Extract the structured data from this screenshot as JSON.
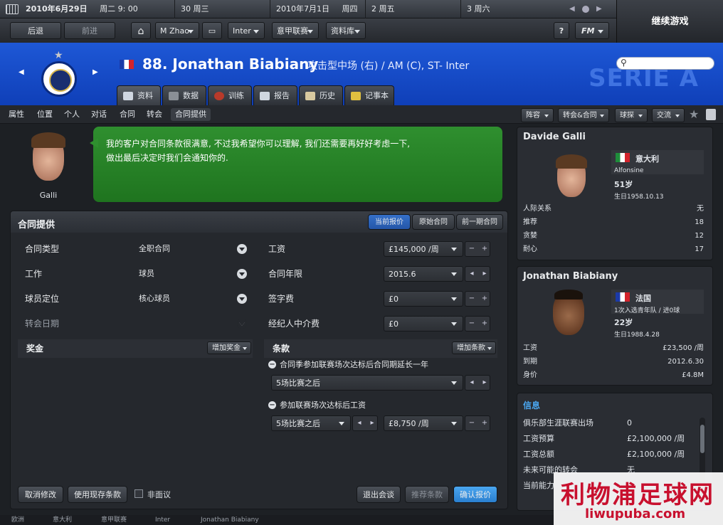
{
  "calendar": {
    "dates": [
      {
        "date": "2010年6月29日",
        "weekday": "周二 9: 00"
      },
      {
        "date": "30 周三",
        "weekday": ""
      },
      {
        "date": "2010年7月1日",
        "weekday": "周四"
      },
      {
        "date": "2 周五",
        "weekday": ""
      },
      {
        "date": "3 周六",
        "weekday": ""
      }
    ]
  },
  "continue_label": "继续游戏",
  "nav": {
    "back": "后退",
    "forward": "前进",
    "manager": "M Zhao",
    "club": "Inter",
    "league": "意甲联赛",
    "database": "资料库",
    "help": "?",
    "fm": "FM"
  },
  "player": {
    "title": "88. Jonathan Biabiany",
    "subtitle": "攻击型中场 (右) / AM (C), ST- Inter",
    "league_logo_text": "SERIE A"
  },
  "header_tabs": [
    {
      "label": "资料",
      "color": "#cfd6e0"
    },
    {
      "label": "数据",
      "color": "#8a8f96"
    },
    {
      "label": "训练",
      "color": "#b83a2a"
    },
    {
      "label": "报告",
      "color": "#cfd6e0"
    },
    {
      "label": "历史",
      "color": "#d8c9a0"
    },
    {
      "label": "记事本",
      "color": "#e0c040"
    }
  ],
  "sub_tabs": [
    "属性",
    "位置",
    "个人",
    "对话",
    "合同",
    "转会",
    "合同提供"
  ],
  "sub_buttons": [
    "阵容",
    "转会&合同",
    "球探",
    "交流"
  ],
  "agent": {
    "name": "Galli",
    "message_line1": "我的客户对合同条款很满意, 不过我希望你可以理解, 我们还需要再好好考虑一下,",
    "message_line2": "做出最后决定时我们会通知你的."
  },
  "offer": {
    "title": "合同提供",
    "view_tabs": [
      "当前报价",
      "原始合同",
      "前一期合同"
    ],
    "left_fields": [
      {
        "label": "合同类型",
        "value": "全职合同"
      },
      {
        "label": "工作",
        "value": "球员"
      },
      {
        "label": "球员定位",
        "value": "核心球员"
      },
      {
        "label": "转会日期",
        "value": ""
      }
    ],
    "right_fields": [
      {
        "label": "工资",
        "value": "£145,000 /周"
      },
      {
        "label": "合同年限",
        "value": "2015.6"
      },
      {
        "label": "签字费",
        "value": "£0"
      },
      {
        "label": "经纪人中介费",
        "value": "£0"
      }
    ],
    "bonus_title": "奖金",
    "bonus_add": "增加奖金",
    "clauses_title": "条款",
    "clauses_add": "增加条款",
    "clauses": [
      {
        "label": "合同季参加联赛场次达标后合同期延长一年",
        "option": "5场比赛之后",
        "value": ""
      },
      {
        "label": "参加联赛场次达标后工资",
        "option": "5场比赛之后",
        "value": "£8,750 /周"
      }
    ],
    "buttons": {
      "cancel": "取消修改",
      "use_existing": "使用现存条款",
      "non_negotiable": "非面议",
      "leave": "退出会谈",
      "suggest": "推荐条款",
      "confirm": "确认报价"
    }
  },
  "agent_card": {
    "name": "Davide Galli",
    "nationality": "意大利",
    "city": "Alfonsine",
    "age": "51岁",
    "birth": "生日1958.10.13",
    "rows": [
      {
        "k": "人际关系",
        "v": "无"
      },
      {
        "k": "推荐",
        "v": "18"
      },
      {
        "k": "贪婪",
        "v": "12"
      },
      {
        "k": "耐心",
        "v": "17"
      }
    ]
  },
  "player_card": {
    "name": "Jonathan Biabiany",
    "nationality": "法国",
    "caps": "1次入选青年队 / 进0球",
    "age": "22岁",
    "birth": "生日1988.4.28",
    "rows": [
      {
        "k": "工资",
        "v": "£23,500 /周"
      },
      {
        "k": "到期",
        "v": "2012.6.30"
      },
      {
        "k": "身价",
        "v": "£4.8M"
      }
    ]
  },
  "info_card": {
    "title": "信息",
    "rows": [
      {
        "k": "俱乐部生涯联赛出场",
        "v": "0"
      },
      {
        "k": "工资预算",
        "v": "£2,100,000 /周"
      },
      {
        "k": "工资总额",
        "v": "£2,100,000 /周"
      },
      {
        "k": "未来可能的转会",
        "v": "无"
      },
      {
        "k": "当前能力",
        "v": ""
      }
    ]
  },
  "bottom_bar": [
    "欧洲",
    "意大利",
    "意甲联赛",
    "Inter",
    "Jonathan Biabiany"
  ],
  "watermark": {
    "text": "利物浦足球网",
    "url": "liwupuba.com"
  }
}
